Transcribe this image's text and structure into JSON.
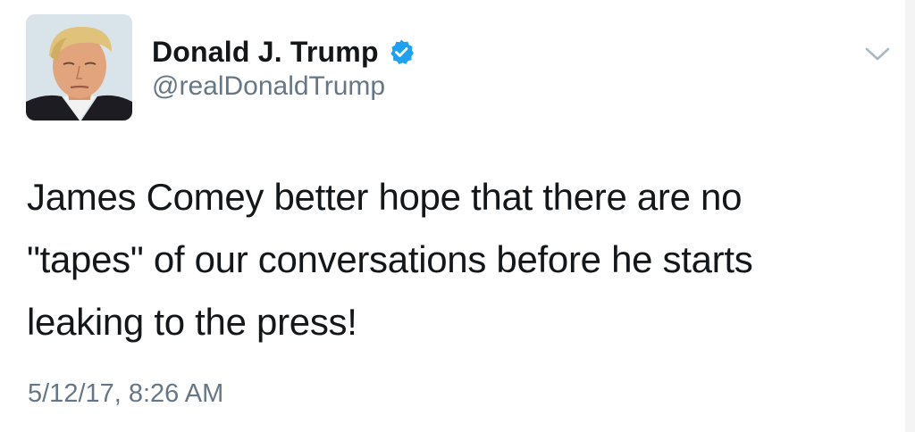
{
  "tweet": {
    "display_name": "Donald J. Trump",
    "handle": "@realDonaldTrump",
    "verified": true,
    "text": "James Comey better hope that there are no\n\"tapes\" of our conversations before he starts\nleaking to the press!",
    "timestamp": "5/12/17, 8:26 AM"
  },
  "icons": {
    "verified": "verified-badge-icon",
    "menu": "chevron-down-icon"
  },
  "colors": {
    "verified_blue": "#1da1f2",
    "secondary_text": "#657786",
    "primary_text": "#14171a"
  }
}
